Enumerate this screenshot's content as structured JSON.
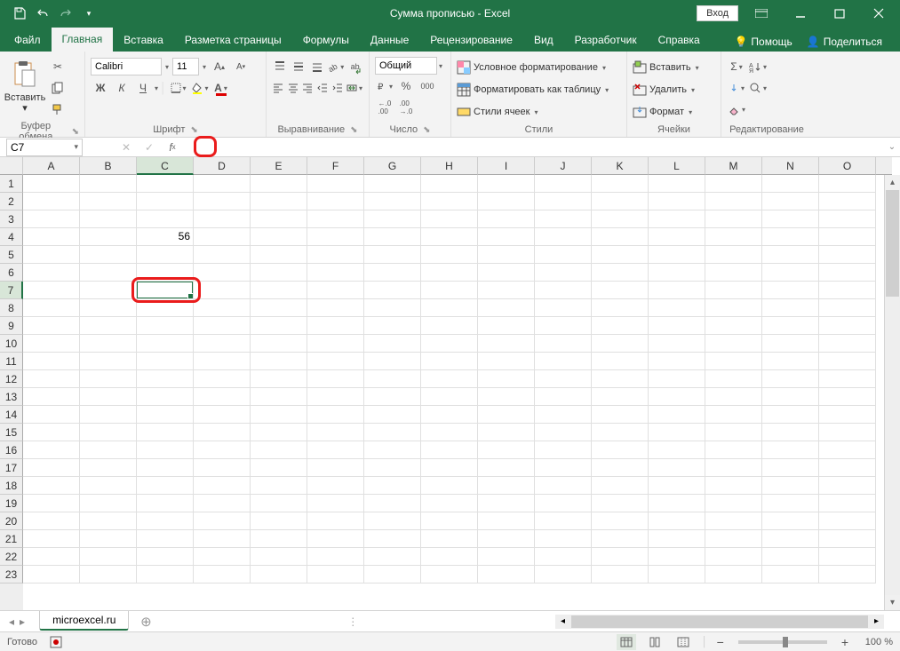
{
  "titlebar": {
    "title": "Сумма прописью - Excel",
    "login": "Вход"
  },
  "tabs": {
    "file": "Файл",
    "home": "Главная",
    "insert": "Вставка",
    "layout": "Разметка страницы",
    "formulas": "Формулы",
    "data": "Данные",
    "review": "Рецензирование",
    "view": "Вид",
    "developer": "Разработчик",
    "help": "Справка",
    "tellme": "Помощь",
    "share": "Поделиться"
  },
  "ribbon": {
    "clipboard": {
      "label": "Буфер обмена",
      "paste": "Вставить"
    },
    "font": {
      "label": "Шрифт",
      "name": "Calibri",
      "size": "11"
    },
    "align": {
      "label": "Выравнивание"
    },
    "number": {
      "label": "Число",
      "format": "Общий"
    },
    "styles": {
      "label": "Стили",
      "cond": "Условное форматирование",
      "table": "Форматировать как таблицу",
      "cell": "Стили ячеек"
    },
    "cells": {
      "label": "Ячейки",
      "insert": "Вставить",
      "delete": "Удалить",
      "format": "Формат"
    },
    "editing": {
      "label": "Редактирование"
    }
  },
  "formula_bar": {
    "namebox": "C7",
    "formula": ""
  },
  "grid": {
    "columns": [
      "A",
      "B",
      "C",
      "D",
      "E",
      "F",
      "G",
      "H",
      "I",
      "J",
      "K",
      "L",
      "M",
      "N",
      "O"
    ],
    "rows": [
      "1",
      "2",
      "3",
      "4",
      "5",
      "6",
      "7",
      "8",
      "9",
      "10",
      "11",
      "12",
      "13",
      "14",
      "15",
      "16",
      "17",
      "18",
      "19",
      "20",
      "21",
      "22",
      "23"
    ],
    "selected_col": "C",
    "selected_row": "7",
    "data": {
      "C4": "56"
    },
    "selection": "C7"
  },
  "sheets": {
    "name": "microexcel.ru"
  },
  "statusbar": {
    "ready": "Готово",
    "zoom": "100 %"
  }
}
